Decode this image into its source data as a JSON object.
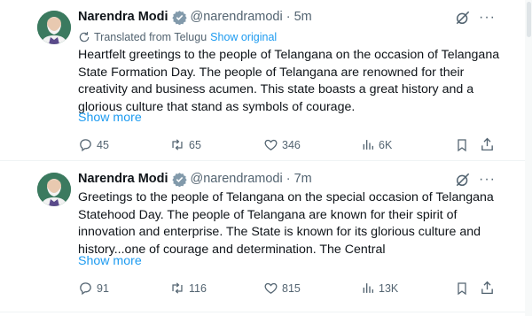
{
  "tweets": [
    {
      "author": "Narendra Modi",
      "handle": "@narendramodi",
      "separator": "·",
      "time": "5m",
      "more_label": "···",
      "translated_label": "Translated from Telugu",
      "show_original_label": "Show original",
      "text": "Heartfelt greetings to the people of Telangana on the occasion of Telangana State Formation Day. The people of Telangana are renowned for their creativity and business acumen. This state boasts a great history and a glorious culture that stand as symbols of courage.",
      "show_more_label": "Show more",
      "replies": "45",
      "reposts": "65",
      "likes": "346",
      "views": "6K"
    },
    {
      "author": "Narendra Modi",
      "handle": "@narendramodi",
      "separator": "·",
      "time": "7m",
      "more_label": "···",
      "text": "Greetings to the people of Telangana on the special occasion of Telangana Statehood Day. The people of Telangana are known for their spirit of innovation and enterprise. The State is known for its glorious culture and history...one of courage and determination. The Central",
      "show_more_label": "Show more",
      "replies": "91",
      "reposts": "116",
      "likes": "815",
      "views": "13K"
    }
  ],
  "colors": {
    "accent": "#1d9bf0",
    "secondary_text": "#536471",
    "primary_text": "#0f1419",
    "divider": "#eff3f4"
  },
  "icons": [
    "verified-badge-icon",
    "grok-icon",
    "more-icon",
    "translate-icon",
    "reply-icon",
    "repost-icon",
    "like-icon",
    "views-icon",
    "bookmark-icon",
    "share-icon"
  ]
}
